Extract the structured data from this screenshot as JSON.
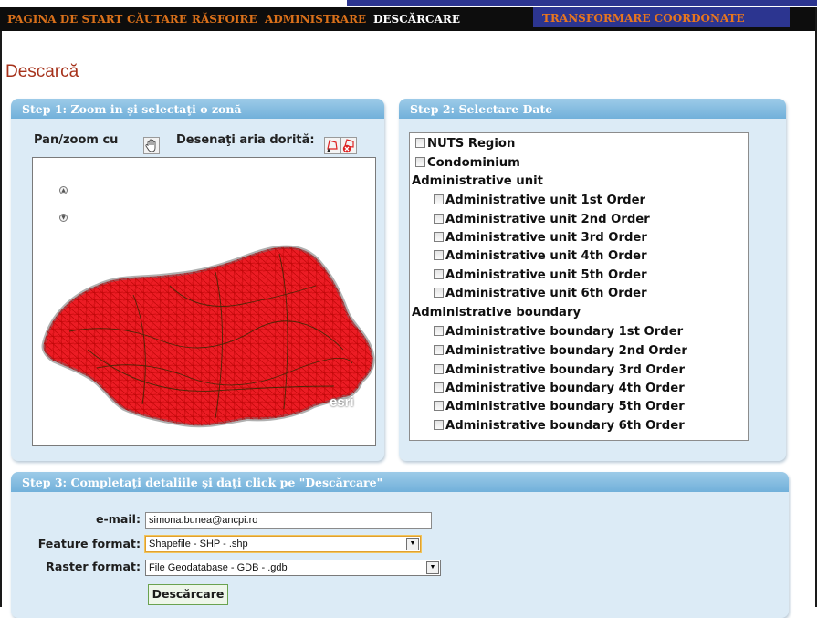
{
  "nav": {
    "items": [
      {
        "label": "PAGINA DE START"
      },
      {
        "label": "CĂUTARE"
      },
      {
        "label": "RĂSFOIRE"
      },
      {
        "label": "ADMINISTRARE"
      },
      {
        "label": "DESCĂRCARE"
      },
      {
        "label": "TRANSFORMARE COORDONATE"
      }
    ],
    "active": "DESCĂRCARE"
  },
  "page": {
    "title": "Descarcă"
  },
  "step1": {
    "title": "Step 1: Zoom in şi selectaţi o zonă",
    "pan_label": "Pan/zoom cu",
    "draw_label": "Desenaţi aria dorită:",
    "map_logo": "esri"
  },
  "step2": {
    "title": "Step 2: Selectare Date",
    "top_items": [
      {
        "label": "NUTS Region",
        "checked": false
      },
      {
        "label": "Condominium",
        "checked": false
      }
    ],
    "groups": [
      {
        "label": "Administrative unit",
        "items": [
          {
            "label": "Administrative unit 1st Order",
            "checked": false
          },
          {
            "label": "Administrative unit 2nd Order",
            "checked": false
          },
          {
            "label": "Administrative unit 3rd Order",
            "checked": false
          },
          {
            "label": "Administrative unit 4th Order",
            "checked": false
          },
          {
            "label": "Administrative unit 5th Order",
            "checked": false
          },
          {
            "label": "Administrative unit 6th Order",
            "checked": false
          }
        ]
      },
      {
        "label": "Administrative boundary",
        "items": [
          {
            "label": "Administrative boundary 1st Order",
            "checked": false
          },
          {
            "label": "Administrative boundary 2nd Order",
            "checked": false
          },
          {
            "label": "Administrative boundary 3rd Order",
            "checked": false
          },
          {
            "label": "Administrative boundary 4th Order",
            "checked": false
          },
          {
            "label": "Administrative boundary 5th Order",
            "checked": false
          },
          {
            "label": "Administrative boundary 6th Order",
            "checked": false
          }
        ]
      }
    ]
  },
  "step3": {
    "title": "Step 3: Completaţi detaliile şi daţi click pe \"Descărcare\"",
    "email_label": "e-mail:",
    "email_value": "simona.bunea@ancpi.ro",
    "feature_label": "Feature format:",
    "feature_value": "Shapefile - SHP - .shp",
    "raster_label": "Raster format:",
    "raster_value": "File Geodatabase - GDB - .gdb",
    "download_label": "Descărcare"
  },
  "colors": {
    "nav_bg": "#0d0d0d",
    "nav_text": "#d9701a",
    "panel_header": "#7fb8de",
    "panel_bg": "#dcebf6",
    "title": "#a6321b",
    "map_fill": "#e8141c"
  }
}
